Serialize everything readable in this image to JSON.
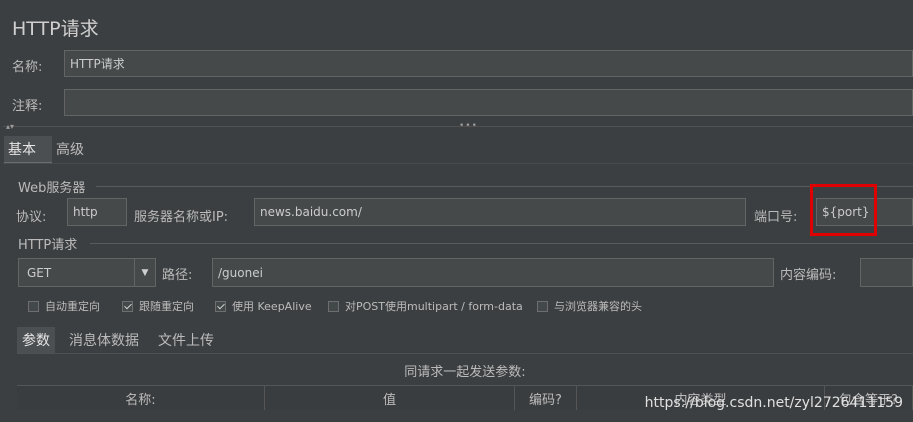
{
  "panel": {
    "title": "HTTP请求"
  },
  "name": {
    "label": "名称:",
    "value": "HTTP请求"
  },
  "comment": {
    "label": "注释:",
    "value": ""
  },
  "tabs": [
    "基本",
    "高级"
  ],
  "web_server": {
    "section_title": "Web服务器",
    "protocol_label": "协议:",
    "protocol_value": "http",
    "server_label": "服务器名称或IP:",
    "server_value": "news.baidu.com/",
    "port_label": "端口号:",
    "port_value": "${port}",
    "highlight_color": "#e00000"
  },
  "http_request": {
    "section_title": "HTTP请求",
    "method_value": "GET",
    "path_label": "路径:",
    "path_value": "/guonei",
    "encoding_label": "内容编码:",
    "encoding_value": ""
  },
  "options": [
    {
      "label": "自动重定向",
      "checked": false
    },
    {
      "label": "跟随重定向",
      "checked": true
    },
    {
      "label": "使用 KeepAlive",
      "checked": true
    },
    {
      "label": "对POST使用multipart / form-data",
      "checked": false
    },
    {
      "label": "与浏览器兼容的头",
      "checked": false
    }
  ],
  "param_tabs": [
    "参数",
    "消息体数据",
    "文件上传"
  ],
  "params_table": {
    "caption": "同请求一起发送参数:",
    "columns": [
      "名称:",
      "值",
      "编码?",
      "内容类型",
      "包含等于?"
    ]
  },
  "watermark": "https://blog.csdn.net/zyl2726411159"
}
